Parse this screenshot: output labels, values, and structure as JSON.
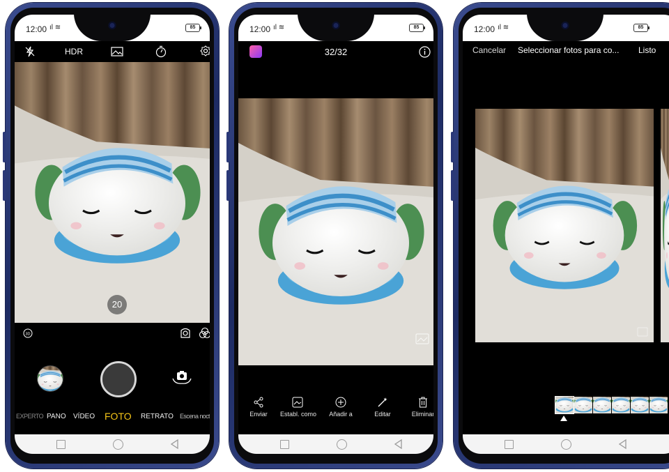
{
  "status": {
    "time": "12:00",
    "battery": "85"
  },
  "camera": {
    "modes": [
      "EXPERTO",
      "PANO",
      "VÍDEO",
      "FOTO",
      "RETRATO",
      "Escena nocturna"
    ],
    "active_mode": "FOTO",
    "zoom_badge": "20",
    "top_icons": [
      "flash-off-icon",
      "hdr-icon",
      "filter-icon",
      "timer-icon",
      "settings-icon"
    ],
    "hdr_label": "HDR"
  },
  "gallery": {
    "counter": "32/32",
    "actions": [
      {
        "label": "Enviar",
        "icon": "share-icon"
      },
      {
        "label": "Establ. como",
        "icon": "set-as-icon"
      },
      {
        "label": "Añadir a",
        "icon": "add-icon"
      },
      {
        "label": "Editar",
        "icon": "edit-icon"
      },
      {
        "label": "Eliminar",
        "icon": "delete-icon"
      }
    ]
  },
  "collage": {
    "cancel_label": "Cancelar",
    "title": "Seleccionar fotos para co...",
    "done_label": "Listo",
    "thumbnail_count": 6
  },
  "colors": {
    "accent_yellow": "#f5c518",
    "frame_blue": "#2c3b7a",
    "towel_blue": "#5fa8d8"
  }
}
